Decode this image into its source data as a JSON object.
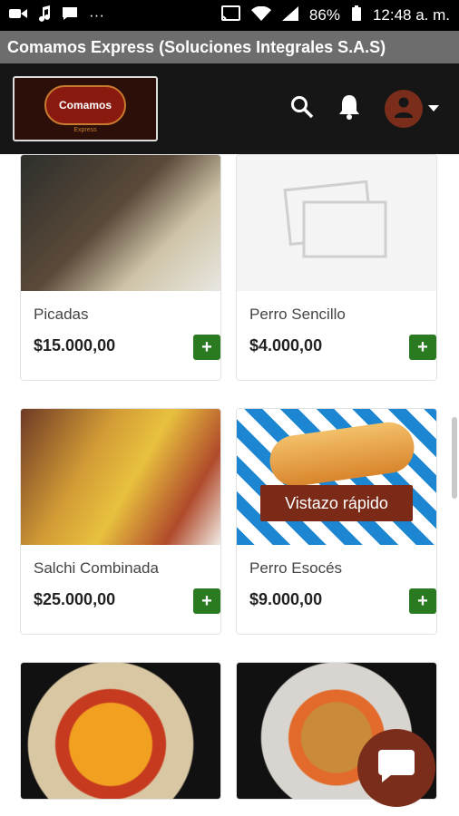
{
  "status": {
    "battery": "86%",
    "time": "12:48 a. m.",
    "dots": "···"
  },
  "window": {
    "title": "Comamos Express (Soluciones Integrales S.A.S)"
  },
  "header": {
    "logo_text": "Comamos",
    "logo_sub": "Express"
  },
  "products": [
    {
      "name": "Picadas",
      "price": "$15.000,00",
      "add": "+"
    },
    {
      "name": "Perro Sencillo",
      "price": "$4.000,00",
      "add": "+"
    },
    {
      "name": "Salchi Combinada",
      "price": "$25.000,00",
      "add": "+"
    },
    {
      "name": "Perro Esocés",
      "price": "$9.000,00",
      "add": "+",
      "quick_view": "Vistazo rápido"
    },
    {
      "name": "",
      "price": "",
      "add": ""
    },
    {
      "name": "",
      "price": "",
      "add": ""
    }
  ],
  "colors": {
    "accent": "#7b2d1b",
    "add_button": "#2a7a22",
    "titlebar": "#6d6d6d"
  },
  "icons": [
    "video-icon",
    "music-icon",
    "message-icon",
    "cast-icon",
    "wifi-icon",
    "signal-icon",
    "battery-icon",
    "search-icon",
    "bell-icon",
    "user-icon",
    "chevron-down-icon",
    "chat-icon",
    "image-placeholder-icon"
  ]
}
